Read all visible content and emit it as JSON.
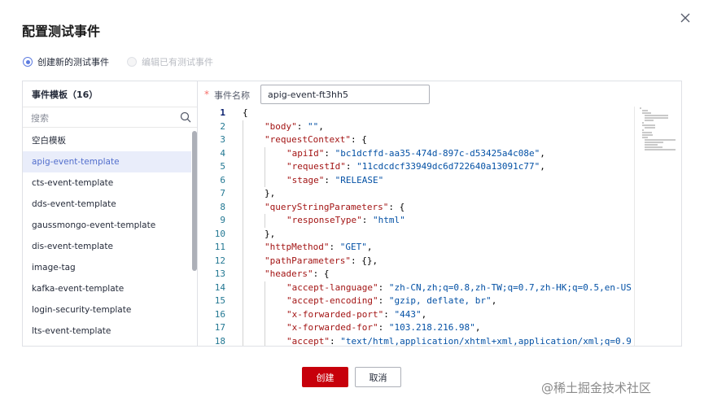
{
  "dialog": {
    "title": "配置测试事件",
    "close_icon": "close-icon"
  },
  "mode": {
    "options": [
      {
        "label": "创建新的测试事件",
        "checked": true,
        "disabled": false
      },
      {
        "label": "编辑已有测试事件",
        "checked": false,
        "disabled": true
      }
    ]
  },
  "templates": {
    "header": "事件模板（16）",
    "search_placeholder": "搜索",
    "items": [
      "空白模板",
      "apig-event-template",
      "cts-event-template",
      "dds-event-template",
      "gaussmongo-event-template",
      "dis-event-template",
      "image-tag",
      "kafka-event-template",
      "login-security-template",
      "lts-event-template"
    ],
    "selected_index": 1
  },
  "event": {
    "required_mark": "*",
    "name_label": "事件名称",
    "name_value": "apig-event-ft3hh5"
  },
  "editor": {
    "active_line": 1,
    "lines": [
      {
        "n": "1",
        "indent": 0,
        "tokens": [
          [
            "p",
            "{"
          ]
        ]
      },
      {
        "n": "2",
        "indent": 1,
        "tokens": [
          [
            "k",
            "\"body\""
          ],
          [
            "p",
            ": "
          ],
          [
            "s",
            "\"\""
          ],
          [
            "p",
            ","
          ]
        ]
      },
      {
        "n": "3",
        "indent": 1,
        "tokens": [
          [
            "k",
            "\"requestContext\""
          ],
          [
            "p",
            ": {"
          ]
        ]
      },
      {
        "n": "4",
        "indent": 2,
        "tokens": [
          [
            "k",
            "\"apiId\""
          ],
          [
            "p",
            ": "
          ],
          [
            "s",
            "\"bc1dcffd-aa35-474d-897c-d53425a4c08e\""
          ],
          [
            "p",
            ","
          ]
        ]
      },
      {
        "n": "5",
        "indent": 2,
        "tokens": [
          [
            "k",
            "\"requestId\""
          ],
          [
            "p",
            ": "
          ],
          [
            "s",
            "\"11cdcdcf33949dc6d722640a13091c77\""
          ],
          [
            "p",
            ","
          ]
        ]
      },
      {
        "n": "6",
        "indent": 2,
        "tokens": [
          [
            "k",
            "\"stage\""
          ],
          [
            "p",
            ": "
          ],
          [
            "s",
            "\"RELEASE\""
          ]
        ]
      },
      {
        "n": "7",
        "indent": 1,
        "tokens": [
          [
            "p",
            "},"
          ]
        ]
      },
      {
        "n": "8",
        "indent": 1,
        "tokens": [
          [
            "k",
            "\"queryStringParameters\""
          ],
          [
            "p",
            ": {"
          ]
        ]
      },
      {
        "n": "9",
        "indent": 2,
        "tokens": [
          [
            "k",
            "\"responseType\""
          ],
          [
            "p",
            ": "
          ],
          [
            "s",
            "\"html\""
          ]
        ]
      },
      {
        "n": "10",
        "indent": 1,
        "tokens": [
          [
            "p",
            "},"
          ]
        ]
      },
      {
        "n": "11",
        "indent": 1,
        "tokens": [
          [
            "k",
            "\"httpMethod\""
          ],
          [
            "p",
            ": "
          ],
          [
            "s",
            "\"GET\""
          ],
          [
            "p",
            ","
          ]
        ]
      },
      {
        "n": "12",
        "indent": 1,
        "tokens": [
          [
            "k",
            "\"pathParameters\""
          ],
          [
            "p",
            ": {},"
          ]
        ]
      },
      {
        "n": "13",
        "indent": 1,
        "tokens": [
          [
            "k",
            "\"headers\""
          ],
          [
            "p",
            ": {"
          ]
        ]
      },
      {
        "n": "14",
        "indent": 2,
        "tokens": [
          [
            "k",
            "\"accept-language\""
          ],
          [
            "p",
            ": "
          ],
          [
            "s",
            "\"zh-CN,zh;q=0.8,zh-TW;q=0.7,zh-HK;q=0.5,en-US"
          ]
        ]
      },
      {
        "n": "15",
        "indent": 2,
        "tokens": [
          [
            "k",
            "\"accept-encoding\""
          ],
          [
            "p",
            ": "
          ],
          [
            "s",
            "\"gzip, deflate, br\""
          ],
          [
            "p",
            ","
          ]
        ]
      },
      {
        "n": "16",
        "indent": 2,
        "tokens": [
          [
            "k",
            "\"x-forwarded-port\""
          ],
          [
            "p",
            ": "
          ],
          [
            "s",
            "\"443\""
          ],
          [
            "p",
            ","
          ]
        ]
      },
      {
        "n": "17",
        "indent": 2,
        "tokens": [
          [
            "k",
            "\"x-forwarded-for\""
          ],
          [
            "p",
            ": "
          ],
          [
            "s",
            "\"103.218.216.98\""
          ],
          [
            "p",
            ","
          ]
        ]
      },
      {
        "n": "18",
        "indent": 2,
        "tokens": [
          [
            "k",
            "\"accept\""
          ],
          [
            "p",
            ": "
          ],
          [
            "s",
            "\"text/html,application/xhtml+xml,application/xml;q=0.9"
          ]
        ]
      }
    ]
  },
  "buttons": {
    "create": "创建",
    "cancel": "取消"
  },
  "watermark": {
    "text": "@稀土掘金技术社区"
  },
  "colors": {
    "primary": "#c7000b",
    "accent": "#5e7ce0",
    "json_key": "#a31515",
    "json_string": "#0451a5"
  }
}
